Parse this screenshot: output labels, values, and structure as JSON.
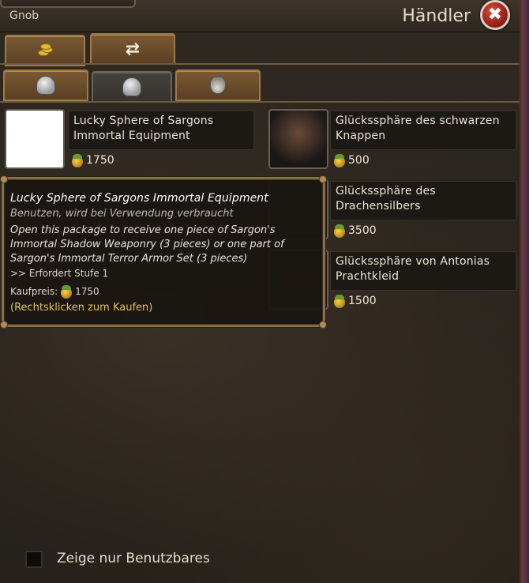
{
  "header": {
    "player_name": "Gnob",
    "title": "Händler",
    "close_symbol": "✖"
  },
  "tabs_primary": [
    {
      "name": "coins-icon",
      "active": false
    },
    {
      "name": "swap-icon",
      "active": true
    }
  ],
  "tabs_secondary": [
    {
      "name": "helmet-icon",
      "active": false
    },
    {
      "name": "helmet-icon",
      "active": true
    },
    {
      "name": "acorn-icon",
      "active": false
    }
  ],
  "swap_symbol": "⇄",
  "items_left": [
    {
      "name": "Lucky Sphere of Sargons Immortal Equipment",
      "price": "1750"
    }
  ],
  "items_right": [
    {
      "name": "Glückssphäre des schwarzen Knappen",
      "price": "500"
    },
    {
      "name": "Glückssphäre des Drachensilbers",
      "price": "3500"
    },
    {
      "name": "Glückssphäre von Antonias Prachtkleid",
      "price": "1500"
    }
  ],
  "tooltip": {
    "title": "Lucky Sphere of Sargons Immortal Equipment",
    "subtitle": "Benutzen, wird bei Verwendung verbraucht",
    "description": "Open this package to receive one piece of Sargon's Immortal Shadow Weaponry (3 pieces) or one part of Sargon's Immortal Terror Armor Set (3 pieces)",
    "requirement": ">> Erfordert Stufe 1",
    "price_label": "Kaufpreis:",
    "price_value": "1750",
    "hint": "(Rechtsklicken zum Kaufen)"
  },
  "filter": {
    "label": "Zeige nur Benutzbares",
    "checked": false
  },
  "colors": {
    "accent_gold": "#e0c24a",
    "panel_bg": "#2a241d",
    "tab_brown": "#6a4a2a",
    "close_red": "#c0392b"
  }
}
